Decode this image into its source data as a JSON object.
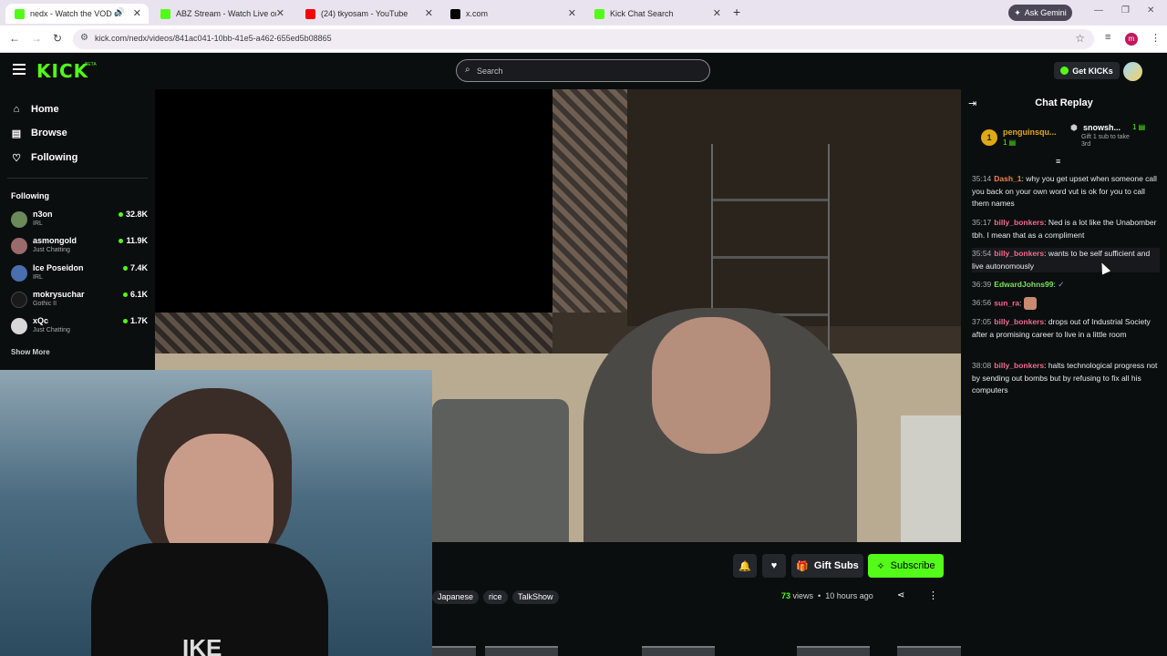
{
  "browser": {
    "tabs": [
      {
        "title": "nedx - Watch the VOD on",
        "active": true,
        "favicon_color": "#53fc18",
        "audio_icon": "speaker-icon"
      },
      {
        "title": "ABZ Stream - Watch Live on Kic",
        "active": false,
        "favicon_color": "#53fc18"
      },
      {
        "title": "(24) tkyosam - YouTube",
        "active": false,
        "favicon_color": "#ff0000"
      },
      {
        "title": "x.com",
        "active": false,
        "favicon_color": "#000000"
      },
      {
        "title": "Kick Chat Search",
        "active": false,
        "favicon_color": "#53fc18"
      }
    ],
    "ask_gemini": "Ask Gemini",
    "url": "kick.com/nedx/videos/841ac041-10bb-41e5-a462-655ed5b08865",
    "profile_initial": "m"
  },
  "kick": {
    "logo": "KICK",
    "beta": "BETA",
    "search_placeholder": "Search",
    "get_kicks": "Get KICKs",
    "accent": "#53fc18"
  },
  "sidebar": {
    "nav": [
      {
        "label": "Home",
        "icon": "home-icon"
      },
      {
        "label": "Browse",
        "icon": "browse-icon"
      },
      {
        "label": "Following",
        "icon": "heart-icon"
      }
    ],
    "following_header": "Following",
    "channels": [
      {
        "name": "n3on",
        "category": "IRL",
        "viewers": "32.8K",
        "avatar_color": "#6b8a5a"
      },
      {
        "name": "asmongold",
        "category": "Just Chatting",
        "viewers": "11.9K",
        "avatar_color": "#9a6b6b"
      },
      {
        "name": "Ice Poseidon",
        "category": "IRL",
        "viewers": "7.4K",
        "avatar_color": "#4a6fb0"
      },
      {
        "name": "mokrysuchar",
        "category": "Gothic II",
        "viewers": "6.1K",
        "avatar_color": "#1a1a1a"
      },
      {
        "name": "xQc",
        "category": "Just Chatting",
        "viewers": "1.7K",
        "avatar_color": "#d8d8d8"
      }
    ],
    "show_more": "Show More"
  },
  "video": {
    "shirt_text": "IKE",
    "actions": {
      "gift_subs": "Gift Subs",
      "subscribe": "Subscribe"
    },
    "tags": [
      "Japanese",
      "rice",
      "TalkShow"
    ],
    "views_count": "73",
    "views_label": "views",
    "time_ago": "10 hours ago"
  },
  "chat": {
    "title": "Chat Replay",
    "pinned": [
      {
        "rank": "1",
        "name": "penguinsqu...",
        "count": "1"
      },
      {
        "name": "snowsh...",
        "count": "1",
        "note": "Gift 1 sub to take 3rd"
      }
    ],
    "messages": [
      {
        "time": "35:14",
        "user": "Dash_1",
        "color": "#f0834a",
        "text": "why you get upset when someone call you back on your own word vut is ok for you to call them names",
        "highlight": false
      },
      {
        "time": "35:17",
        "user": "billy_bonkers",
        "color": "#f06b8f",
        "text": "Ned is a lot like the Unabomber tbh. I mean that as a compliment",
        "highlight": false
      },
      {
        "time": "35:54",
        "user": "billy_bonkers",
        "color": "#f06b8f",
        "text": "wants to be self sufficient and live autonomously",
        "highlight": true
      },
      {
        "time": "36:39",
        "user": "EdwardJohns99",
        "color": "#7ee05b",
        "text": "",
        "highlight": false
      },
      {
        "time": "36:56",
        "user": "sun_ra",
        "color": "#f06b8f",
        "text": "",
        "highlight": false
      },
      {
        "time": "37:05",
        "user": "billy_bonkers",
        "color": "#f06b8f",
        "text": "drops out of Industrial Society after a promising career to live in a little room",
        "highlight": false
      },
      {
        "time": "38:08",
        "user": "billy_bonkers",
        "color": "#f06b8f",
        "text": "halts technological progress not by sending out bombs but by refusing to fix all his computers",
        "highlight": false
      }
    ]
  }
}
